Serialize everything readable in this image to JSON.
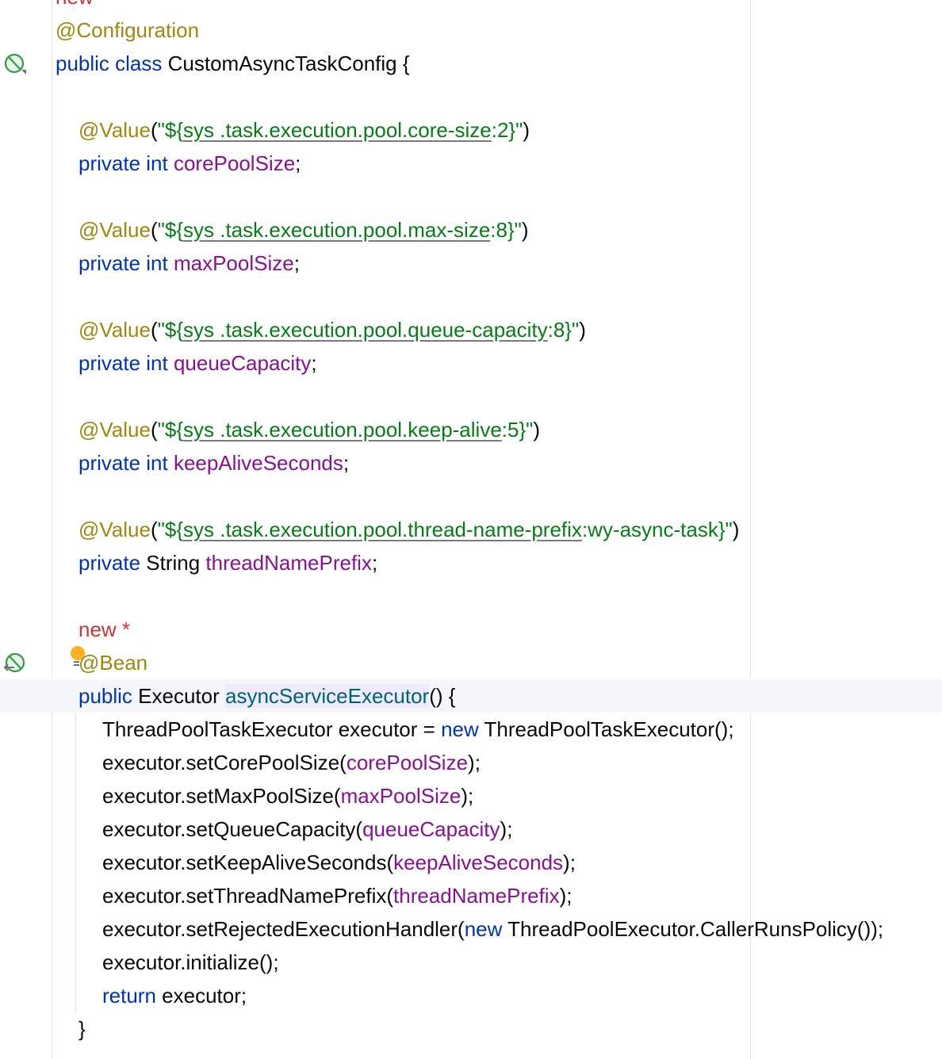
{
  "editor": {
    "lines": [
      {
        "indent": 0,
        "tokens": [
          {
            "c": "new",
            "t": "new"
          }
        ]
      },
      {
        "indent": 0,
        "tokens": [
          {
            "c": "ann",
            "t": "@Configuration"
          }
        ]
      },
      {
        "indent": 0,
        "tokens": [
          {
            "c": "kw",
            "t": "public class "
          },
          {
            "c": "plain",
            "t": "CustomAsyncTaskConfig {"
          }
        ]
      },
      {
        "indent": 0,
        "tokens": []
      },
      {
        "indent": 1,
        "tokens": [
          {
            "c": "ann",
            "t": "@Value"
          },
          {
            "c": "plain",
            "t": "("
          },
          {
            "c": "str",
            "t": "\"${"
          },
          {
            "c": "strU",
            "t": "sys .task.execution.pool.core-size"
          },
          {
            "c": "str",
            "t": ":2}\""
          },
          {
            "c": "plain",
            "t": ")"
          }
        ]
      },
      {
        "indent": 1,
        "tokens": [
          {
            "c": "kw",
            "t": "private int "
          },
          {
            "c": "field",
            "t": "corePoolSize"
          },
          {
            "c": "plain",
            "t": ";"
          }
        ]
      },
      {
        "indent": 0,
        "tokens": []
      },
      {
        "indent": 1,
        "tokens": [
          {
            "c": "ann",
            "t": "@Value"
          },
          {
            "c": "plain",
            "t": "("
          },
          {
            "c": "str",
            "t": "\"${"
          },
          {
            "c": "strU",
            "t": "sys .task.execution.pool.max-size"
          },
          {
            "c": "str",
            "t": ":8}\""
          },
          {
            "c": "plain",
            "t": ")"
          }
        ]
      },
      {
        "indent": 1,
        "tokens": [
          {
            "c": "kw",
            "t": "private int "
          },
          {
            "c": "field",
            "t": "maxPoolSize"
          },
          {
            "c": "plain",
            "t": ";"
          }
        ]
      },
      {
        "indent": 0,
        "tokens": []
      },
      {
        "indent": 1,
        "tokens": [
          {
            "c": "ann",
            "t": "@Value"
          },
          {
            "c": "plain",
            "t": "("
          },
          {
            "c": "str",
            "t": "\"${"
          },
          {
            "c": "strU",
            "t": "sys .task.execution.pool.queue-capacity"
          },
          {
            "c": "str",
            "t": ":8}\""
          },
          {
            "c": "plain",
            "t": ")"
          }
        ]
      },
      {
        "indent": 1,
        "tokens": [
          {
            "c": "kw",
            "t": "private int "
          },
          {
            "c": "field",
            "t": "queueCapacity"
          },
          {
            "c": "plain",
            "t": ";"
          }
        ]
      },
      {
        "indent": 0,
        "tokens": []
      },
      {
        "indent": 1,
        "tokens": [
          {
            "c": "ann",
            "t": "@Value"
          },
          {
            "c": "plain",
            "t": "("
          },
          {
            "c": "str",
            "t": "\"${"
          },
          {
            "c": "strU",
            "t": "sys .task.execution.pool.keep-alive"
          },
          {
            "c": "str",
            "t": ":5}\""
          },
          {
            "c": "plain",
            "t": ")"
          }
        ]
      },
      {
        "indent": 1,
        "tokens": [
          {
            "c": "kw",
            "t": "private int "
          },
          {
            "c": "field",
            "t": "keepAliveSeconds"
          },
          {
            "c": "plain",
            "t": ";"
          }
        ]
      },
      {
        "indent": 0,
        "tokens": []
      },
      {
        "indent": 1,
        "tokens": [
          {
            "c": "ann",
            "t": "@Value"
          },
          {
            "c": "plain",
            "t": "("
          },
          {
            "c": "str",
            "t": "\"${"
          },
          {
            "c": "strU",
            "t": "sys .task.execution.pool.thread-name-prefix"
          },
          {
            "c": "str",
            "t": ":wy-async-task}\""
          },
          {
            "c": "plain",
            "t": ")"
          }
        ]
      },
      {
        "indent": 1,
        "tokens": [
          {
            "c": "kw",
            "t": "private "
          },
          {
            "c": "plain",
            "t": "String "
          },
          {
            "c": "field",
            "t": "threadNamePrefix"
          },
          {
            "c": "plain",
            "t": ";"
          }
        ]
      },
      {
        "indent": 0,
        "tokens": []
      },
      {
        "indent": 1,
        "tokens": [
          {
            "c": "new",
            "t": "new *"
          }
        ]
      },
      {
        "indent": 1,
        "tokens": [
          {
            "c": "ann",
            "t": "@Bean"
          }
        ]
      },
      {
        "indent": 1,
        "highlight": true,
        "tokens": [
          {
            "c": "kw",
            "t": "public "
          },
          {
            "c": "plain",
            "t": "Executor "
          },
          {
            "c": "method",
            "t": "asyncServiceExecutor"
          },
          {
            "c": "plain",
            "t": "() {"
          }
        ]
      },
      {
        "indent": 2,
        "tokens": [
          {
            "c": "plain",
            "t": "ThreadPoolTaskExecutor executor = "
          },
          {
            "c": "kw",
            "t": "new "
          },
          {
            "c": "plain",
            "t": "ThreadPoolTaskExecutor();"
          }
        ]
      },
      {
        "indent": 2,
        "tokens": [
          {
            "c": "plain",
            "t": "executor.setCorePoolSize("
          },
          {
            "c": "field",
            "t": "corePoolSize"
          },
          {
            "c": "plain",
            "t": ");"
          }
        ]
      },
      {
        "indent": 2,
        "tokens": [
          {
            "c": "plain",
            "t": "executor.setMaxPoolSize("
          },
          {
            "c": "field",
            "t": "maxPoolSize"
          },
          {
            "c": "plain",
            "t": ");"
          }
        ]
      },
      {
        "indent": 2,
        "tokens": [
          {
            "c": "plain",
            "t": "executor.setQueueCapacity("
          },
          {
            "c": "field",
            "t": "queueCapacity"
          },
          {
            "c": "plain",
            "t": ");"
          }
        ]
      },
      {
        "indent": 2,
        "tokens": [
          {
            "c": "plain",
            "t": "executor.setKeepAliveSeconds("
          },
          {
            "c": "field",
            "t": "keepAliveSeconds"
          },
          {
            "c": "plain",
            "t": ");"
          }
        ]
      },
      {
        "indent": 2,
        "tokens": [
          {
            "c": "plain",
            "t": "executor.setThreadNamePrefix("
          },
          {
            "c": "field",
            "t": "threadNamePrefix"
          },
          {
            "c": "plain",
            "t": ");"
          }
        ]
      },
      {
        "indent": 2,
        "tokens": [
          {
            "c": "plain",
            "t": "executor.setRejectedExecutionHandler("
          },
          {
            "c": "kw",
            "t": "new "
          },
          {
            "c": "plain",
            "t": "ThreadPoolExecutor.CallerRunsPolicy());"
          }
        ]
      },
      {
        "indent": 2,
        "tokens": [
          {
            "c": "plain",
            "t": "executor.initialize();"
          }
        ]
      },
      {
        "indent": 2,
        "tokens": [
          {
            "c": "kw",
            "t": "return "
          },
          {
            "c": "plain",
            "t": "executor;"
          }
        ]
      },
      {
        "indent": 1,
        "tokens": [
          {
            "c": "plain",
            "t": "}"
          }
        ]
      }
    ]
  },
  "gutter_icons": [
    "spring-bean-icon",
    "spring-bean-navigate-icon",
    "intention-bulb-icon"
  ],
  "colors": {
    "keyword": "#0033b3",
    "annotation": "#9e880d",
    "string": "#067d17",
    "field": "#871094",
    "new_marker": "#c7373a",
    "method": "#00627a"
  }
}
